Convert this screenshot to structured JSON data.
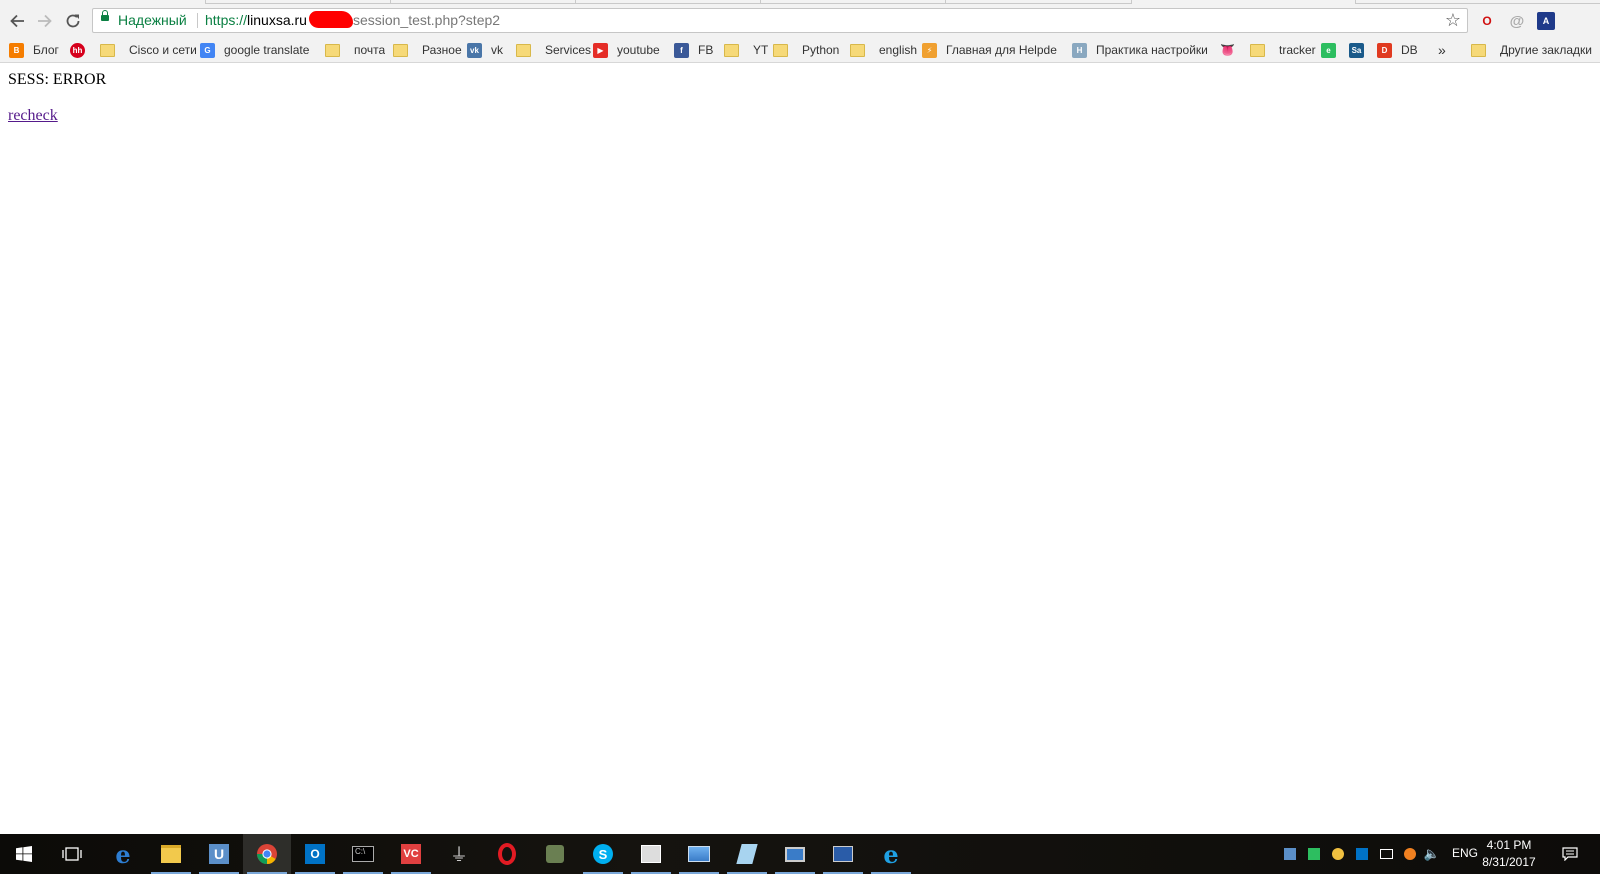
{
  "browser": {
    "security_label": "Надежный",
    "url_scheme": "https://",
    "url_host": "linuxsa.ru",
    "url_path": "session_test.php?step2"
  },
  "bookmarks": [
    {
      "label": "Блог",
      "icon": "blogger-icon",
      "color": "#f57d00"
    },
    {
      "label": "",
      "icon": "hh-icon",
      "color": "#d6001c",
      "text": "hh"
    },
    {
      "label": "Cisco и сети",
      "icon": "folder-icon"
    },
    {
      "label": "google translate",
      "icon": "google-translate-icon",
      "color": "#4285f4"
    },
    {
      "label": "почта",
      "icon": "folder-icon"
    },
    {
      "label": "Разное",
      "icon": "folder-icon"
    },
    {
      "label": "vk",
      "icon": "vk-icon",
      "color": "#4a76a8"
    },
    {
      "label": "Services",
      "icon": "folder-icon"
    },
    {
      "label": "youtube",
      "icon": "youtube-icon",
      "color": "#e52d27"
    },
    {
      "label": "FB",
      "icon": "facebook-icon",
      "color": "#3b5998"
    },
    {
      "label": "YT",
      "icon": "folder-icon"
    },
    {
      "label": "Python",
      "icon": "folder-icon"
    },
    {
      "label": "english",
      "icon": "folder-icon"
    },
    {
      "label": "Главная для Helpdes",
      "icon": "helpdesk-icon",
      "color": "#f0a030"
    },
    {
      "label": "Практика настройки",
      "icon": "h-icon",
      "color": "#8aa8c0"
    },
    {
      "label": "",
      "icon": "rolling-stones-icon",
      "color": "#d01010"
    },
    {
      "label": "tracker",
      "icon": "folder-icon"
    },
    {
      "label": "",
      "icon": "evernote-icon",
      "color": "#2dbe60"
    },
    {
      "label": "",
      "icon": "sa-icon",
      "color": "#1a5a8a"
    },
    {
      "label": "DB",
      "icon": "d-icon",
      "color": "#e03a20"
    }
  ],
  "bookmarks_overflow": "»",
  "other_bookmarks": "Другие закладки",
  "page": {
    "status_text": "SESS: ERROR",
    "link_text": "recheck"
  },
  "taskbar": {
    "language": "ENG",
    "time": "4:01 PM",
    "date": "8/31/2017"
  }
}
